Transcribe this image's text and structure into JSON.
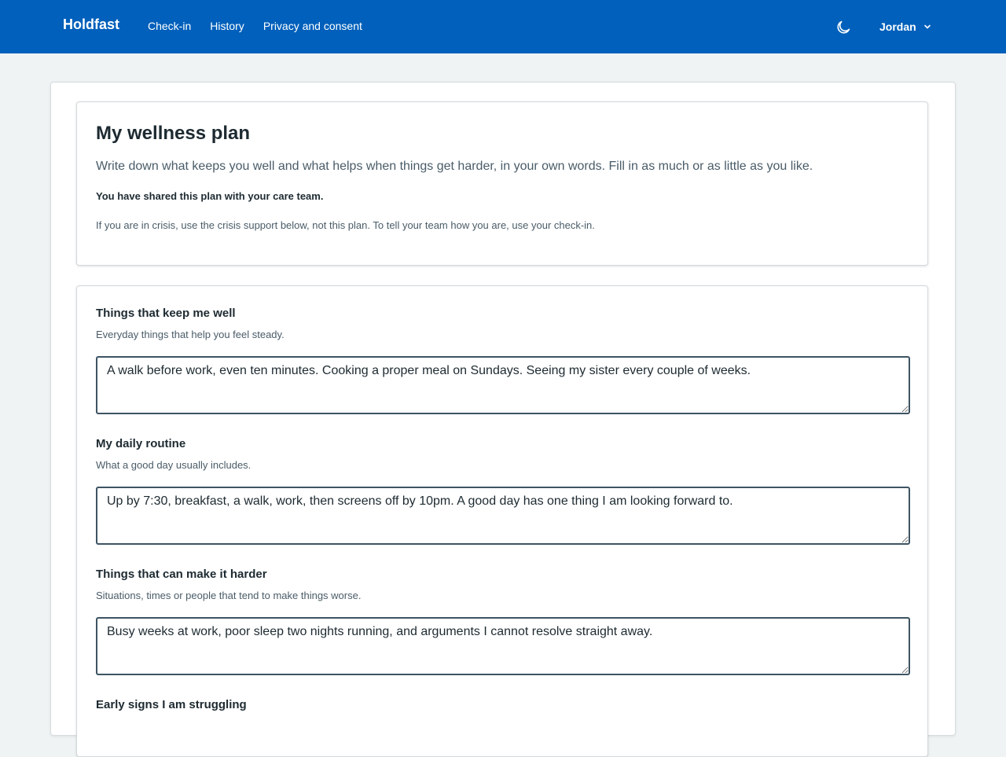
{
  "header": {
    "brand": "Holdfast",
    "nav": [
      "Check-in",
      "History",
      "Privacy and consent"
    ],
    "theme_icon": "moon-icon",
    "user_name": "Jordan",
    "user_menu_icon": "chevron-down-icon",
    "background_color": "#0060bb"
  },
  "intro": {
    "title": "My wellness plan",
    "description": "Write down what keeps you well and what helps when things get harder, in your own words. Fill in as much or as little as you like.",
    "shared_notice": "You have shared this plan with your care team.",
    "crisis_note": "If you are in crisis, use the crisis support below, not this plan. To tell your team how you are, use your check-in."
  },
  "plan": {
    "fields": [
      {
        "label": "Things that keep me well",
        "hint": "Everyday things that help you feel steady.",
        "value": "A walk before work, even ten minutes. Cooking a proper meal on Sundays. Seeing my sister every couple of weeks."
      },
      {
        "label": "My daily routine",
        "hint": "What a good day usually includes.",
        "value": "Up by 7:30, breakfast, a walk, work, then screens off by 10pm. A good day has one thing I am looking forward to."
      },
      {
        "label": "Things that can make it harder",
        "hint": "Situations, times or people that tend to make things worse.",
        "value": "Busy weeks at work, poor sleep two nights running, and arguments I cannot resolve straight away."
      },
      {
        "label": "Early signs I am struggling"
      }
    ]
  }
}
